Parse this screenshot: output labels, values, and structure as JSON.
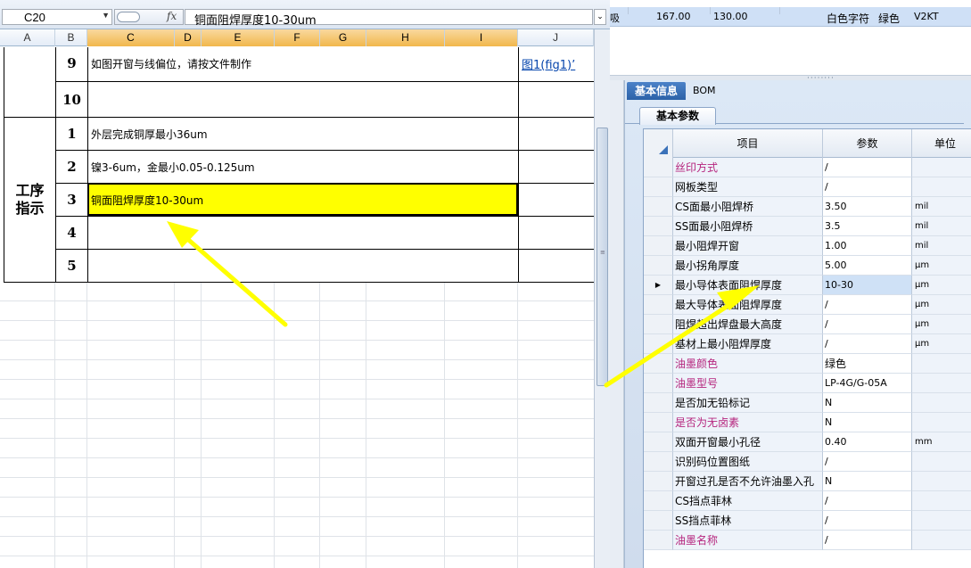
{
  "excel": {
    "name_box": "C20",
    "fx_label": "fx",
    "formula": "铜面阻焊厚度10-30um",
    "columns": [
      "A",
      "B",
      "C",
      "D",
      "E",
      "F",
      "G",
      "H",
      "I",
      "J"
    ],
    "rows": {
      "r9": {
        "num": "9",
        "text": "如图开窗与线偏位，请按文件制作",
        "link": "图1(fig1)’"
      },
      "r10": {
        "num": "10",
        "text": ""
      },
      "section": "工序\n指示",
      "r1": {
        "num": "1",
        "text": "外层完成铜厚最小36um"
      },
      "r2": {
        "num": "2",
        "text": "镍3-6um，金最小0.05-0.125um"
      },
      "r3": {
        "num": "3",
        "text": "铜面阻焊厚度10-30um"
      },
      "r4": {
        "num": "4",
        "text": ""
      },
      "r5": {
        "num": "5",
        "text": ""
      }
    }
  },
  "top_row": {
    "frag": "吸",
    "v1": "167.00",
    "v2": "130.00",
    "text": "白色字符",
    "color": "绿色",
    "code": "V2KT"
  },
  "panel": {
    "tabs": [
      "基本信息",
      "BOM"
    ],
    "subtab": "基本参数",
    "headers": {
      "item": "项目",
      "param": "参数",
      "unit": "单位"
    },
    "rows": [
      {
        "name": "丝印方式",
        "value": "/",
        "unit": "",
        "pink": true
      },
      {
        "name": "网板类型",
        "value": "/",
        "unit": ""
      },
      {
        "name": "CS面最小阻焊桥",
        "value": "3.50",
        "unit": "mil"
      },
      {
        "name": "SS面最小阻焊桥",
        "value": "3.5",
        "unit": "mil"
      },
      {
        "name": "最小阻焊开窗",
        "value": "1.00",
        "unit": "mil"
      },
      {
        "name": "最小拐角厚度",
        "value": "5.00",
        "unit": "μm"
      },
      {
        "name": "最小导体表面阻焊厚度",
        "value": "10-30",
        "unit": "μm",
        "selected": true
      },
      {
        "name": "最大导体表面阻焊厚度",
        "value": "/",
        "unit": "μm"
      },
      {
        "name": "阻焊超出焊盘最大高度",
        "value": "/",
        "unit": "μm"
      },
      {
        "name": "基材上最小阻焊厚度",
        "value": "/",
        "unit": "μm"
      },
      {
        "name": "油墨颜色",
        "value": "绿色",
        "unit": "",
        "pink": true
      },
      {
        "name": "油墨型号",
        "value": "LP-4G/G-05A",
        "unit": "",
        "pink": true
      },
      {
        "name": "是否加无铅标记",
        "value": "N",
        "unit": ""
      },
      {
        "name": "是否为无卤素",
        "value": "N",
        "unit": "",
        "pink": true
      },
      {
        "name": "双面开窗最小孔径",
        "value": "0.40",
        "unit": "mm"
      },
      {
        "name": "识别码位置图纸",
        "value": "/",
        "unit": ""
      },
      {
        "name": "开窗过孔是否不允许油墨入孔",
        "value": "N",
        "unit": ""
      },
      {
        "name": "CS挡点菲林",
        "value": "/",
        "unit": ""
      },
      {
        "name": "SS挡点菲林",
        "value": "/",
        "unit": ""
      },
      {
        "name": "油墨名称",
        "value": "/",
        "unit": "",
        "pink": true
      }
    ]
  },
  "colors": {
    "highlight": "#ffff00",
    "arrow": "#ffff00",
    "pink_label": "#b5247d",
    "tab_blue": "#2c62a8"
  },
  "icons": [
    "dropdown-arrow-icon",
    "row-pointer-icon",
    "sort-corner-icon",
    "expand-icon"
  ]
}
